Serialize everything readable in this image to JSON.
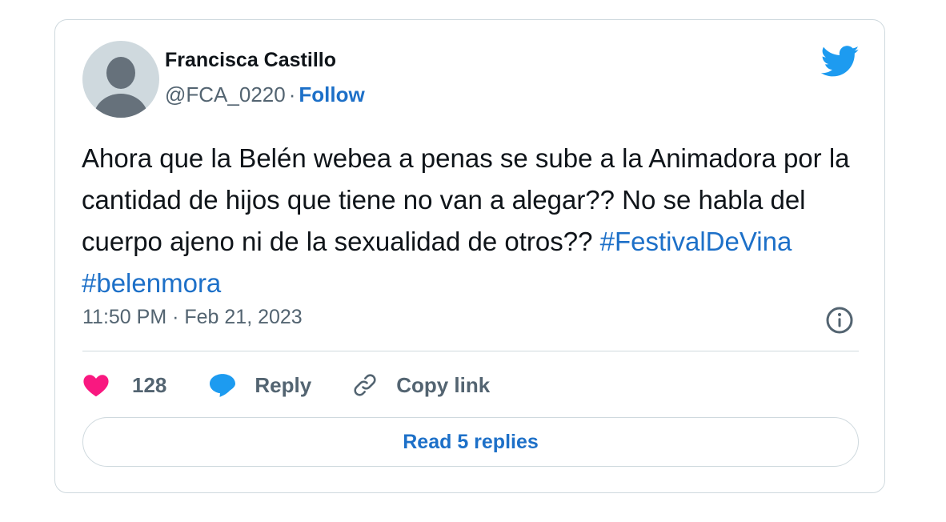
{
  "author": {
    "name": "Francisca Castillo",
    "handle": "@FCA_0220",
    "separator": "·",
    "follow_label": "Follow"
  },
  "tweet": {
    "text": "Ahora que la Belén webea a penas se sube a la Animadora por la cantidad de hijos que tiene no van a alegar?? No se habla del cuerpo ajeno ni de la sexualidad de otros?? ",
    "hashtags": [
      "#FestivalDeVina",
      "#belenmora"
    ],
    "timestamp": "11:50 PM · Feb 21, 2023"
  },
  "actions": {
    "like_count": "128",
    "reply_label": "Reply",
    "copy_link_label": "Copy link"
  },
  "read_replies_label": "Read 5 replies",
  "icons": {
    "platform": "twitter-bird-icon",
    "info": "info-icon",
    "like": "heart-icon",
    "reply": "speech-bubble-icon",
    "copy": "link-icon"
  },
  "colors": {
    "link": "#1d70c8",
    "bird": "#1d9bf0",
    "heart": "#f91880",
    "reply_bubble": "#1d9bf0",
    "secondary_text": "#536471",
    "border": "#cfd9de"
  }
}
